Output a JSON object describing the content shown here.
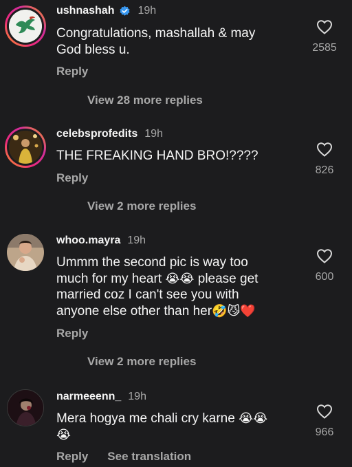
{
  "comments": [
    {
      "username": "ushnashah",
      "verified": true,
      "time": "19h",
      "text_lines": [
        "Congratulations, mashallah & may",
        "God bless u."
      ],
      "likes": "2585",
      "reply_label": "Reply",
      "view_more": "View 28 more replies"
    },
    {
      "username": "celebsprofedits",
      "time": "19h",
      "text_lines": [
        "THE FREAKING HAND BRO!????"
      ],
      "likes": "826",
      "reply_label": "Reply",
      "view_more": "View 2 more replies"
    },
    {
      "username": "whoo.mayra",
      "time": "19h",
      "text_lines": [
        "Ummm the second pic is way too",
        "much for my heart",
        "please get",
        "married coz I can't see you with",
        "anyone else other than her"
      ],
      "emojis": {
        "line2": "😭😭",
        "line4": "🤣😼❤️"
      },
      "likes": "600",
      "reply_label": "Reply",
      "view_more": "View 2 more replies"
    },
    {
      "username": "narmeeenn_",
      "time": "19h",
      "text_lines": [
        "Mera hogya me chali cry karne"
      ],
      "emojis": {
        "line1": "😭😭",
        "line2": "😭"
      },
      "likes": "966",
      "reply_label": "Reply",
      "see_translation": "See translation"
    }
  ],
  "icons": {
    "heart": "heart-outline-icon",
    "verified": "verified-badge-icon"
  },
  "colors": {
    "background": "#1c1c1e",
    "text": "#f5f5f5",
    "muted": "#a8a8a8",
    "verified": "#3897f0",
    "story_ring_start": "#f9a31b",
    "story_ring_end": "#d12d9a"
  }
}
